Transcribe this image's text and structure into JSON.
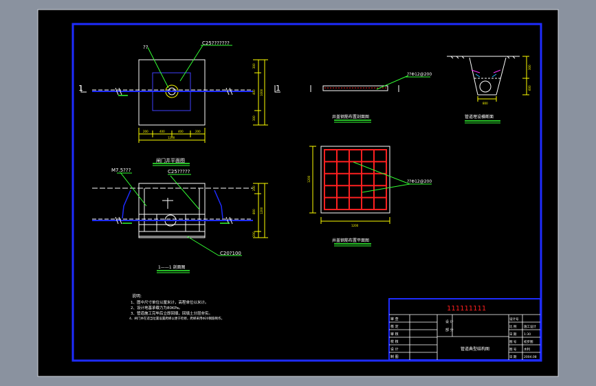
{
  "window": {
    "background": "#8a929f",
    "canvas_color": "#000000"
  },
  "colors": {
    "frame": "#1e2cff",
    "line": "#ffffff",
    "accent_yellow": "#ffff00",
    "accent_red": "#ff2020",
    "accent_green": "#33ff33",
    "accent_magenta": "#ff33ff",
    "accent_cyan": "#22bbff"
  },
  "plan_view": {
    "title": "闸门井平面图",
    "leader_label_a": "??",
    "leader_label_b": "C25???????",
    "section_mark_left": "1",
    "section_mark_right": "1",
    "dims_bottom": [
      "200",
      "400",
      "400",
      "200"
    ],
    "dims_total": "1200",
    "dims_right": [
      "300",
      "400",
      "300"
    ],
    "dims_right_total": "1000"
  },
  "section_view": {
    "title": "1——1 剖面图",
    "label_pipe": "M7.5???",
    "label_cover": "C25?????",
    "label_base": "C20?100",
    "dims_right": [
      "200",
      "800",
      "200"
    ],
    "dims_right_total": "1200"
  },
  "cover_elevation": {
    "title": "井盖钢筋布置剖面图",
    "label": "??Φ12@200"
  },
  "cover_plan": {
    "title": "井盖钢筋布置平面图",
    "label": "??Φ12@200",
    "dim_bottom": "1200",
    "dim_left": "1200"
  },
  "trench_section": {
    "title": "管道埋设横断面",
    "dim_bottom": "800",
    "dims_right": [
      "300",
      "600"
    ]
  },
  "notes": {
    "heading": "说明:",
    "lines": [
      "1、图中尺寸单位以厘米计，高程单位以米计。",
      "2、设计地基承载力为80KPa。",
      "3、管道施工完毕后立即回填，回填土分层夯实。",
      "4、闸门井在适当位置设置爬梯以便于检修，爬梯采用Φ20钢筋制作。"
    ]
  },
  "title_block": {
    "project": "111111111",
    "drawing_name": "管道典型结构图",
    "left_labels": [
      "审 查",
      "核 定",
      "审 核",
      "校 核",
      "设 计",
      "制 图"
    ],
    "mid_labels": [
      "设 计",
      "部 分"
    ],
    "right_labels": [
      "设计号",
      "比 例",
      "日 期",
      "图 号",
      "图 号",
      "日 期"
    ],
    "right_values": [
      "",
      "施工设计",
      "1:30",
      "初步图",
      "水利",
      "2004.08"
    ]
  }
}
